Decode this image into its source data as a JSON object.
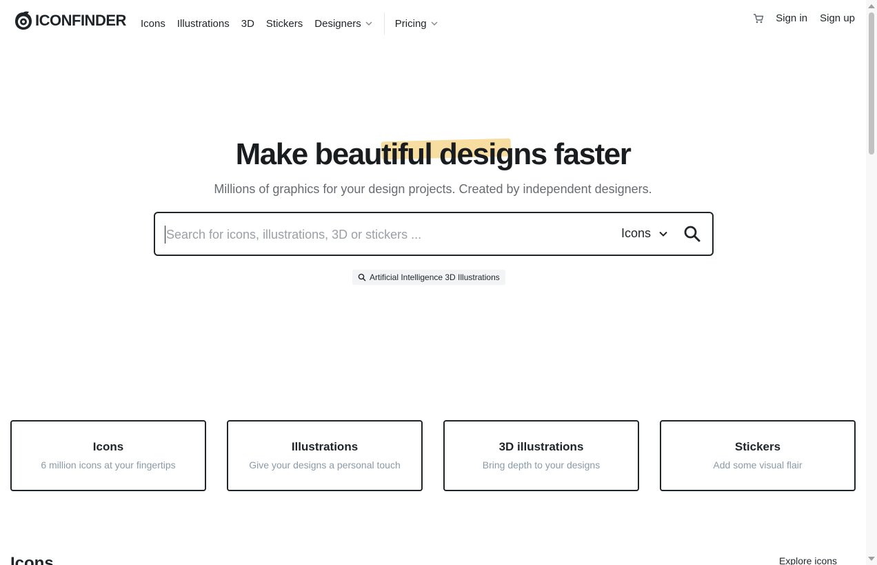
{
  "header": {
    "logo_text": "ICONFINDER",
    "nav": [
      {
        "label": "Icons"
      },
      {
        "label": "Illustrations"
      },
      {
        "label": "3D"
      },
      {
        "label": "Stickers"
      },
      {
        "label": "Designers"
      },
      {
        "label": "Pricing"
      }
    ],
    "sign_in": "Sign in",
    "sign_up": "Sign up"
  },
  "hero": {
    "title_pre": "Make be",
    "title_highlight": "autiful designs",
    "title_post": " faster",
    "subtitle": "Millions of graphics for your design projects. Created by independent designers."
  },
  "search": {
    "value": "",
    "placeholder": "Search for icons, illustrations, 3D or stickers ...",
    "type_selected": "Icons",
    "suggestion": "Artificial Intelligence 3D Illustrations"
  },
  "categories": [
    {
      "title": "Icons",
      "desc": "6 million icons at your fingertips"
    },
    {
      "title": "Illustrations",
      "desc": "Give your designs a personal touch"
    },
    {
      "title": "3D illustrations",
      "desc": "Bring depth to your designs"
    },
    {
      "title": "Stickers",
      "desc": "Add some visual flair"
    }
  ],
  "section": {
    "title": "Icons",
    "explore_label": "Explore icons"
  },
  "colors": {
    "text": "#1f2428",
    "highlight": "#f8dda0",
    "muted": "#8a9aa8"
  }
}
